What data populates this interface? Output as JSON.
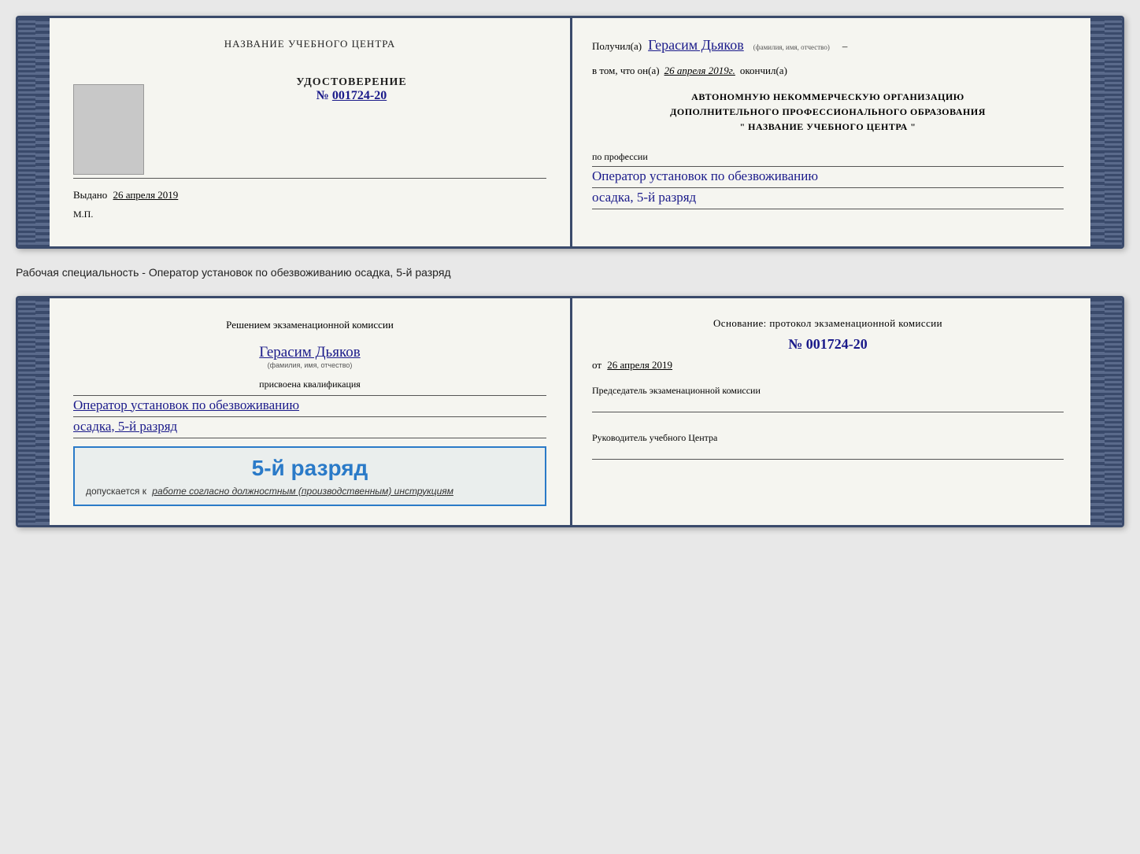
{
  "doc1": {
    "left": {
      "photo_label": "",
      "cert_title": "УДОСТОВЕРЕНИЕ",
      "cert_number_prefix": "№",
      "cert_number": "001724-20",
      "issued_label": "Выдано",
      "issued_date": "26 апреля 2019",
      "mp_label": "М.П."
    },
    "right": {
      "received_prefix": "Получил(а)",
      "name_handwritten": "Герасим Дьяков",
      "name_subtitle": "(фамилия, имя, отчество)",
      "in_that_prefix": "в том, что он(а)",
      "completion_date": "26 апреля 2019г.",
      "finished_label": "окончил(а)",
      "org_line1": "АВТОНОМНУЮ НЕКОММЕРЧЕСКУЮ ОРГАНИЗАЦИЮ",
      "org_line2": "ДОПОЛНИТЕЛЬНОГО ПРОФЕССИОНАЛЬНОГО ОБРАЗОВАНИЯ",
      "org_line3": "\"   НАЗВАНИЕ УЧЕБНОГО ЦЕНТРА   \"",
      "profession_label": "по профессии",
      "profession_handwritten": "Оператор установок по обезвоживанию",
      "profession_line2": "осадка, 5-й разряд"
    }
  },
  "description": "Рабочая специальность - Оператор установок по обезвоживанию осадка, 5-й разряд",
  "doc2": {
    "left": {
      "decision_text": "Решением экзаменационной комиссии",
      "name_handwritten": "Герасим Дьяков",
      "name_subtitle": "(фамилия, имя, отчество)",
      "assigned_label": "присвоена квалификация",
      "qualification_handwritten": "Оператор установок по обезвоживанию",
      "qualification_line2": "осадка, 5-й разряд",
      "highlight_rank": "5-й разряд",
      "allows_prefix": "допускается к",
      "allows_text": "работе согласно должностным (производственным) инструкциям"
    },
    "right": {
      "basis_label": "Основание: протокол экзаменационной комиссии",
      "protocol_number": "№ 001724-20",
      "date_prefix": "от",
      "protocol_date": "26 апреля 2019",
      "chairman_label": "Председатель экзаменационной комиссии",
      "director_label": "Руководитель учебного Центра"
    }
  },
  "header": {
    "training_center_label": "НАЗВАНИЕ УЧЕБНОГО ЦЕНТРА"
  }
}
